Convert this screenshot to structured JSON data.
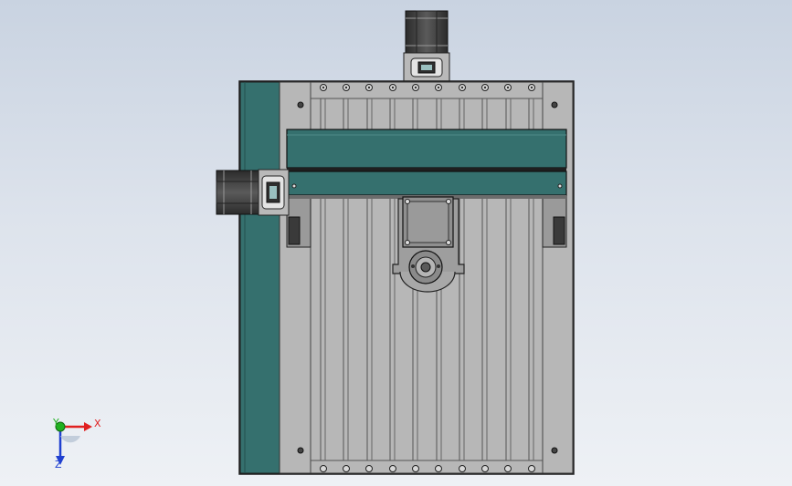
{
  "colors": {
    "background_top": "#c9d3e1",
    "background_bottom": "#eef1f5",
    "plate": "#b4b4b4",
    "plate_edge": "#1e1e1e",
    "teal_panel": "#35706e",
    "motor_dark": "#3c3c3c",
    "axis_x": "#e02020",
    "axis_y": "#20b020",
    "axis_z": "#2040d0"
  },
  "triad": {
    "x_label": "X",
    "y_label": "Y",
    "z_label": "Z"
  },
  "icons": [
    "stepper-motor-icon",
    "coupling-icon",
    "bolt-icon",
    "bearing-icon"
  ]
}
